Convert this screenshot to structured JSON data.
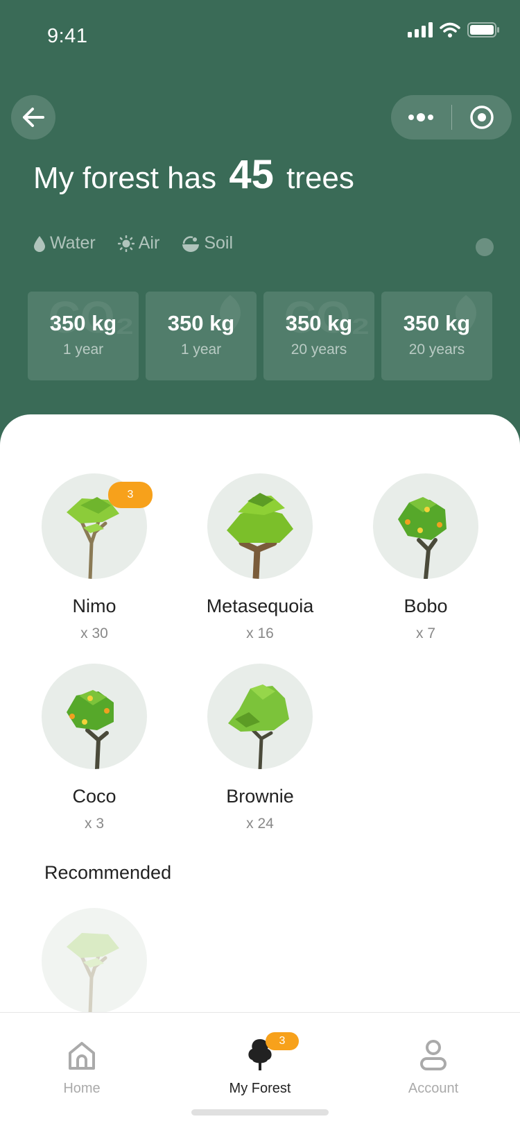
{
  "status_bar": {
    "time": "9:41"
  },
  "header": {
    "title_prefix": "My forest has",
    "tree_count": "45",
    "title_suffix": "trees"
  },
  "env_tabs": [
    {
      "label": "Water",
      "icon": "water-drop-icon"
    },
    {
      "label": "Air",
      "icon": "sun-icon"
    },
    {
      "label": "Soil",
      "icon": "soil-icon"
    }
  ],
  "stats": [
    {
      "value": "350 kg",
      "period": "1 year",
      "watermark": "CO₂"
    },
    {
      "value": "350 kg",
      "period": "1 year",
      "watermark": "leaf"
    },
    {
      "value": "350 kg",
      "period": "20 years",
      "watermark": "CO₂"
    },
    {
      "value": "350 kg",
      "period": "20 years",
      "watermark": "leaf"
    }
  ],
  "trees": [
    {
      "name": "Nimo",
      "count": "x 30",
      "badge": "3"
    },
    {
      "name": "Metasequoia",
      "count": "x 16"
    },
    {
      "name": "Bobo",
      "count": "x 7"
    },
    {
      "name": "Coco",
      "count": "x 3"
    },
    {
      "name": "Brownie",
      "count": "x 24"
    }
  ],
  "recommended": {
    "title": "Recommended"
  },
  "tabbar": {
    "home": "Home",
    "forest": "My Forest",
    "forest_badge": "3",
    "account": "Account"
  },
  "colors": {
    "header_bg": "#3a6b57",
    "badge": "#f7a11b",
    "tree_circle": "#e8ede9"
  }
}
